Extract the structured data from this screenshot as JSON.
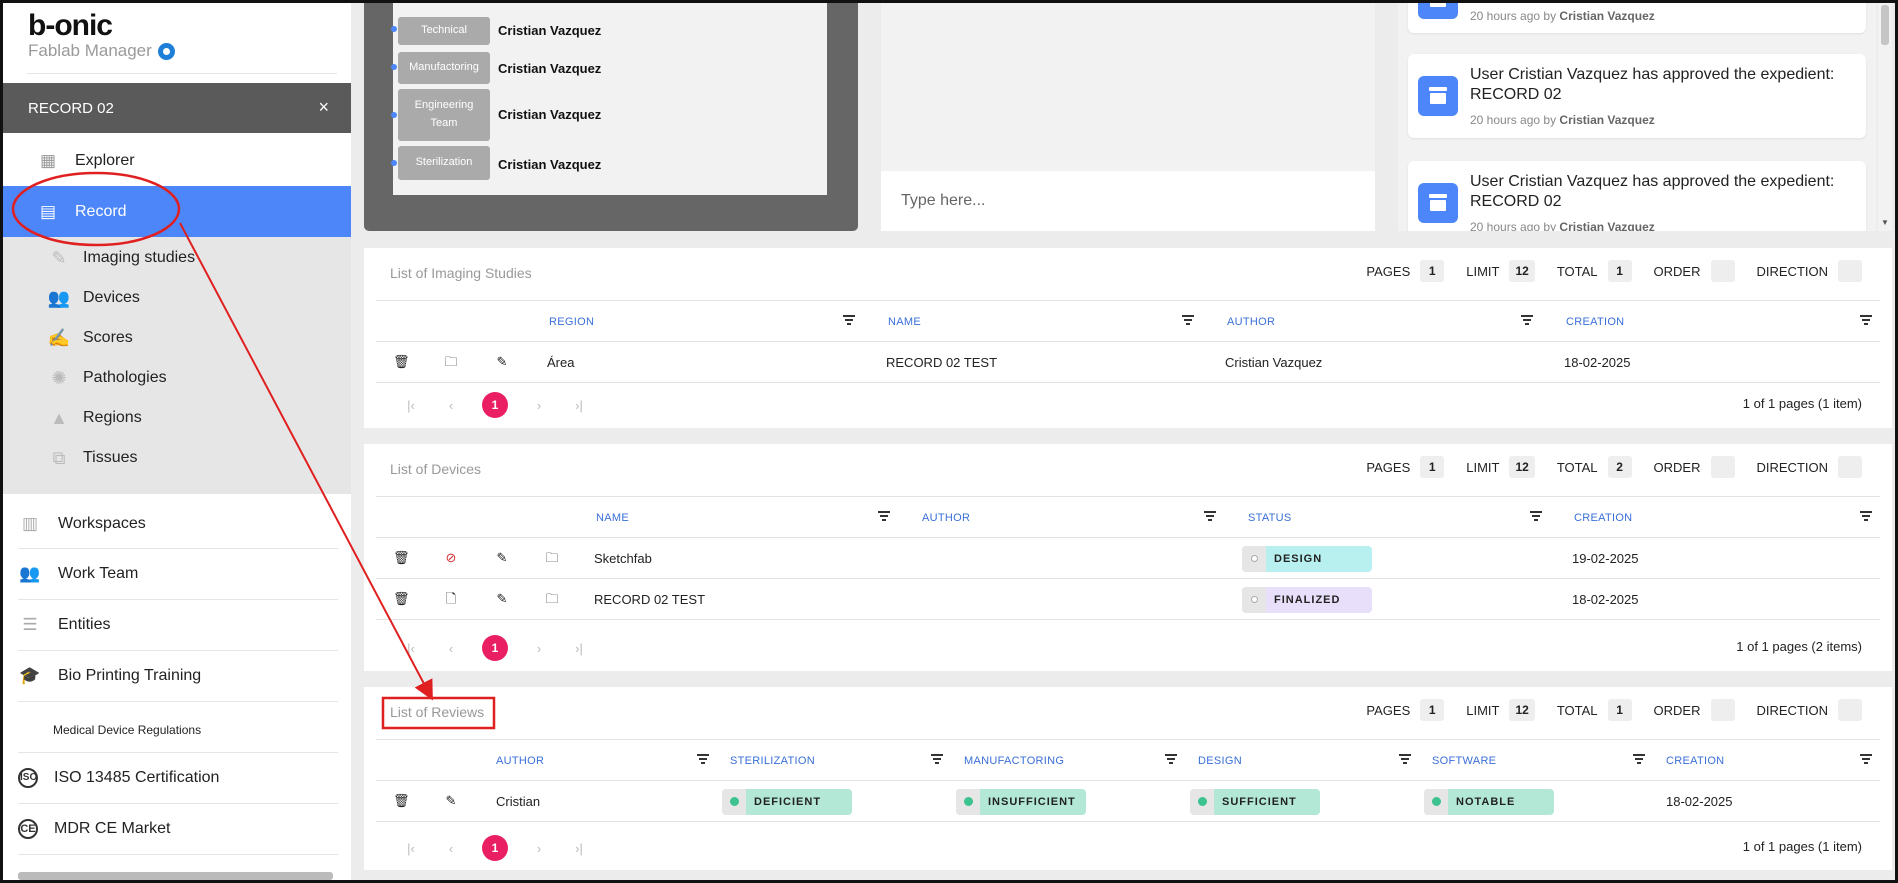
{
  "brand": {
    "logo": "b-onic",
    "subtitle": "Fablab Manager"
  },
  "record_header": {
    "title": "RECORD 02",
    "close": "×"
  },
  "nav": {
    "explorer": "Explorer",
    "record": "Record",
    "sub": [
      "Imaging studies",
      "Devices",
      "Scores",
      "Pathologies",
      "Regions",
      "Tissues"
    ],
    "main": [
      "Workspaces",
      "Work Team",
      "Entities",
      "Bio Printing Training"
    ],
    "section_label": "Medical Device Regulations",
    "regs": [
      "ISO 13485 Certification",
      "MDR CE Market"
    ],
    "iso_icon_text": "ISO",
    "ce_icon_text": "CE"
  },
  "team": [
    {
      "role": "Technical",
      "name": "Cristian Vazquez"
    },
    {
      "role": "Manufactoring",
      "name": "Cristian Vazquez"
    },
    {
      "role": "Engineering Team",
      "name": "Cristian Vazquez"
    },
    {
      "role": "Sterilization",
      "name": "Cristian Vazquez"
    }
  ],
  "chat": {
    "placeholder": "Type here..."
  },
  "activity": [
    {
      "text": "",
      "meta_prefix": "20 hours ago by",
      "meta_user": "Cristian Vazquez"
    },
    {
      "text": "User Cristian Vazquez has approved the expedient: RECORD 02",
      "meta_prefix": "20 hours ago by",
      "meta_user": "Cristian Vazquez"
    },
    {
      "text": "User Cristian Vazquez has approved the expedient: RECORD 02",
      "meta_prefix": "20 hours ago by",
      "meta_user": "Cristian Vazquez"
    }
  ],
  "meta_labels": {
    "pages": "PAGES",
    "limit": "LIMIT",
    "total": "TOTAL",
    "order": "ORDER",
    "direction": "DIRECTION"
  },
  "imaging": {
    "title": "List of Imaging Studies",
    "pages": "1",
    "limit": "12",
    "total": "1",
    "columns": [
      "REGION",
      "NAME",
      "AUTHOR",
      "CREATION"
    ],
    "rows": [
      {
        "region": "Área",
        "name": "RECORD 02 TEST",
        "author": "Cristian Vazquez",
        "creation": "18-02-2025"
      }
    ],
    "current_page": "1",
    "info": "1 of 1 pages (1 item)"
  },
  "devices": {
    "title": "List of Devices",
    "pages": "1",
    "limit": "12",
    "total": "2",
    "columns": [
      "NAME",
      "AUTHOR",
      "STATUS",
      "CREATION"
    ],
    "rows": [
      {
        "name": "Sketchfab",
        "author": "",
        "status": "DESIGN",
        "creation": "19-02-2025"
      },
      {
        "name": "RECORD 02 TEST",
        "author": "",
        "status": "FINALIZED",
        "creation": "18-02-2025"
      }
    ],
    "current_page": "1",
    "info": "1 of 1 pages (2 items)"
  },
  "reviews": {
    "title": "List of Reviews",
    "pages": "1",
    "limit": "12",
    "total": "1",
    "columns": [
      "AUTHOR",
      "STERILIZATION",
      "MANUFACTORING",
      "DESIGN",
      "SOFTWARE",
      "CREATION"
    ],
    "rows": [
      {
        "author": "Cristian",
        "sterilization": "DEFICIENT",
        "manufactoring": "INSUFFICIENT",
        "design": "SUFFICIENT",
        "software": "NOTABLE",
        "creation": "18-02-2025"
      }
    ],
    "current_page": "1",
    "info": "1 of 1 pages (1 item)"
  },
  "colors": {
    "accent": "#4c86f9",
    "annotation": "#e02020",
    "page_active": "#e91e63",
    "badge_design": "#b8f0f0",
    "badge_finalized": "#e8e0fa",
    "badge_review": "#b3e8d6",
    "badge_review_dot": "#3cc38f"
  }
}
